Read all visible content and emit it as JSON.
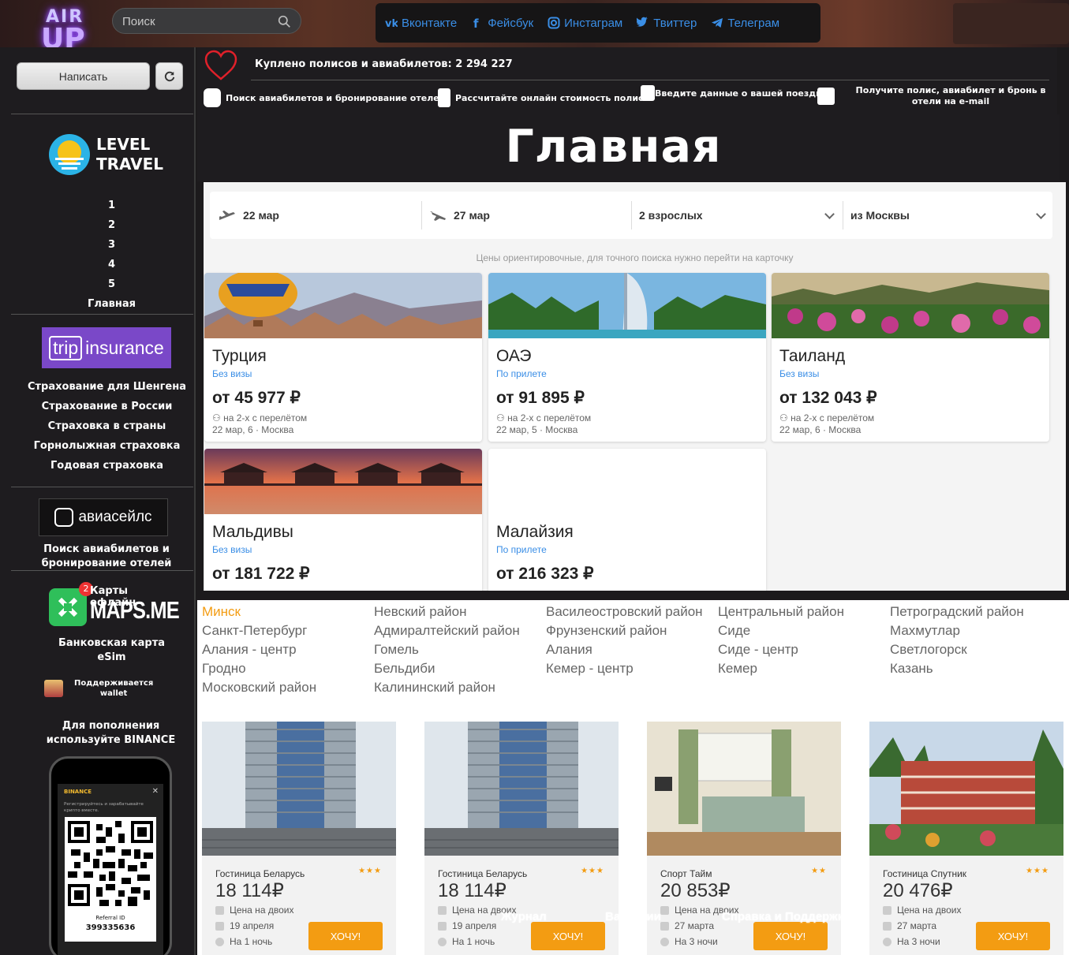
{
  "header": {
    "logo_line1": "AIR",
    "logo_line2": "UP",
    "search_placeholder": "Поиск",
    "social": [
      {
        "label": "Вконтакте",
        "icon": "vk-icon"
      },
      {
        "label": "Фейсбук",
        "icon": "facebook-icon"
      },
      {
        "label": "Инстаграм",
        "icon": "instagram-icon"
      },
      {
        "label": "Твиттер",
        "icon": "twitter-icon"
      },
      {
        "label": "Телеграм",
        "icon": "telegram-icon"
      }
    ]
  },
  "sidebar": {
    "write_label": "Написать",
    "level_travel": {
      "line1": "LEVEL",
      "line2": "TRAVEL"
    },
    "numbers": [
      "1",
      "2",
      "3",
      "4",
      "5",
      "Главная"
    ],
    "trip_insurance": {
      "part1": "trip",
      "part2": "insurance"
    },
    "insurance_links": [
      "Страхование для Шенгена",
      "Страхование в России",
      "Страховка в страны",
      "Горнолыжная страховка",
      "Годовая страховка"
    ],
    "aviasales_logo": "авиасейлс",
    "aviasales_text": "Поиск авиабилетов и бронирование отелей",
    "maps": {
      "badge": "2",
      "caption": "Карты офлайн",
      "logo": "MAPS.ME"
    },
    "bank_text": "Банковская карта eSim",
    "wallet_text": "Поддерживается wallet",
    "binance_text": "Для пополнения используйте BINANCE",
    "phone": {
      "brand": "BINANCE",
      "text": "Регистрируйтесь и зарабатывайте крипто вместе.",
      "ref_label": "Referral ID",
      "ref_id": "399335636"
    }
  },
  "main": {
    "bought_text": "Куплено полисов и авиабилетов: 2 294 227",
    "steps": [
      "Поиск авиабилетов и бронирование отелей",
      "Рассчитайте онлайн стоимость полиса",
      "Введите данные о вашей поездке",
      "Получите полис, авиабилет и бронь в отели на e-mail"
    ],
    "title": "Главная"
  },
  "widget": {
    "date_from": "22 мар",
    "date_to": "27 мар",
    "guests": "2 взрослых",
    "from_city": "из Москвы",
    "note": "Цены ориентировочные, для точного поиска нужно перейти на карточку",
    "cards": [
      {
        "country": "Турция",
        "visa": "Без визы",
        "price": "от 45 977 ₽",
        "meta1": "на 2-х с перелётом",
        "meta2": "22 мар, 6 · Москва"
      },
      {
        "country": "ОАЭ",
        "visa": "По прилете",
        "price": "от 91 895 ₽",
        "meta1": "на 2-х с перелётом",
        "meta2": "22 мар, 5 · Москва"
      },
      {
        "country": "Таиланд",
        "visa": "Без визы",
        "price": "от 132 043 ₽",
        "meta1": "на 2-х с перелётом",
        "meta2": "22 мар, 6 · Москва"
      },
      {
        "country": "Мальдивы",
        "visa": "Без визы",
        "price": "от 181 722 ₽",
        "meta1": "",
        "meta2": ""
      },
      {
        "country": "Малайзия",
        "visa": "По прилете",
        "price": "от 216 323 ₽",
        "meta1": "",
        "meta2": ""
      }
    ]
  },
  "districts": {
    "col1": [
      "Минск",
      "Санкт-Петербург",
      "Алания - центр",
      "Гродно",
      "Московский район"
    ],
    "col2": [
      "Невский район",
      "Адмиралтейский район",
      "Гомель",
      "Бельдиби",
      "Калининский район"
    ],
    "col3": [
      "Василеостровский район",
      "Фрунзенский район",
      "Алания",
      "Кемер - центр"
    ],
    "col4": [
      "Центральный район",
      "Сиде",
      "Сиде - центр",
      "Кемер"
    ],
    "col5": [
      "Петроградский район",
      "Махмутлар",
      "Светлогорск",
      "Казань"
    ]
  },
  "hotels": [
    {
      "name": "Гостиница Беларусь",
      "stars": "★★★",
      "price": "18 114₽",
      "guests": "Цена на двоих",
      "date": "19 апреля",
      "nights": "На 1 ночь",
      "button": "ХОЧУ!"
    },
    {
      "name": "Гостиница Беларусь",
      "stars": "★★★",
      "price": "18 114₽",
      "guests": "Цена на двоих",
      "date": "19 апреля",
      "nights": "На 1 ночь",
      "button": "ХОЧУ!"
    },
    {
      "name": "Спорт Тайм",
      "stars": "★★",
      "price": "20 853₽",
      "guests": "Цена на двоих",
      "date": "27 марта",
      "nights": "На 3 ночи",
      "button": "ХОЧУ!"
    },
    {
      "name": "Гостиница Спутник",
      "stars": "★★★",
      "price": "20 476₽",
      "guests": "Цена на двоих",
      "date": "27 марта",
      "nights": "На 3 ночи",
      "button": "ХОЧУ!"
    }
  ],
  "ghost_text": {
    "a": "Журнал",
    "b": "Вакансии",
    "c": "Справка и Поддержка"
  }
}
